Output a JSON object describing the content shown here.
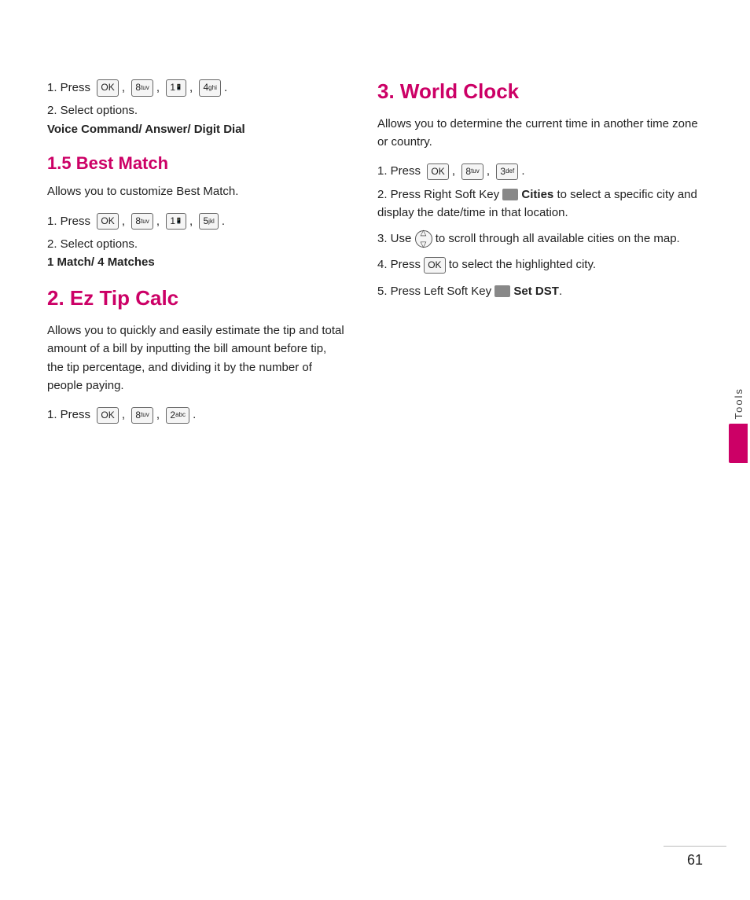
{
  "page": {
    "number": "61",
    "sidebar_label": "Tools"
  },
  "left": {
    "section1": {
      "item1": {
        "prefix": "1. Press",
        "keys": [
          "OK",
          "8tuv",
          "1",
          "4ghi"
        ]
      },
      "item2": {
        "prefix": "2. Select options.",
        "bold": "Voice Command/ Answer/ Digit Dial"
      }
    },
    "section_best_match": {
      "heading": "1.5 Best Match",
      "intro": "Allows you to customize Best Match.",
      "item1": {
        "prefix": "1. Press",
        "keys": [
          "OK",
          "8tuv",
          "1",
          "5jkl"
        ]
      },
      "item2": {
        "prefix": "2. Select options.",
        "bold": "1 Match/ 4 Matches"
      }
    },
    "section_ez": {
      "heading": "2. Ez Tip Calc",
      "intro": "Allows you to quickly and easily estimate the tip and total amount of a bill by inputting the bill amount before tip, the tip percentage, and dividing it by the number of people paying.",
      "item1": {
        "prefix": "1. Press",
        "keys": [
          "OK",
          "8tuv",
          "2abc"
        ]
      }
    }
  },
  "right": {
    "section_world_clock": {
      "heading": "3. World Clock",
      "intro": "Allows you to determine the current time in another time zone or country.",
      "item1": {
        "prefix": "1. Press",
        "keys": [
          "OK",
          "8tuv",
          "3def"
        ]
      },
      "item2": {
        "prefix": "2. Press Right Soft Key",
        "bold_label": "Cities",
        "suffix": "to select a specific city and display the date/time in that location."
      },
      "item3": {
        "prefix": "3. Use",
        "suffix": "to scroll through all available cities on the map."
      },
      "item4": {
        "prefix": "4. Press",
        "key": "OK",
        "suffix": "to select the highlighted city."
      },
      "item5": {
        "prefix": "5. Press Left Soft Key",
        "bold_label": "Set DST",
        "suffix": "."
      }
    }
  },
  "keys": {
    "ok_label": "OK",
    "8_label": "8",
    "8_sup": "tuv",
    "1_label": "1",
    "4_label": "4",
    "4_sup": "ghi",
    "5_label": "5",
    "5_sup": "jkl",
    "2_label": "2",
    "2_sup": "abc",
    "3_label": "3",
    "3_sup": "def"
  }
}
